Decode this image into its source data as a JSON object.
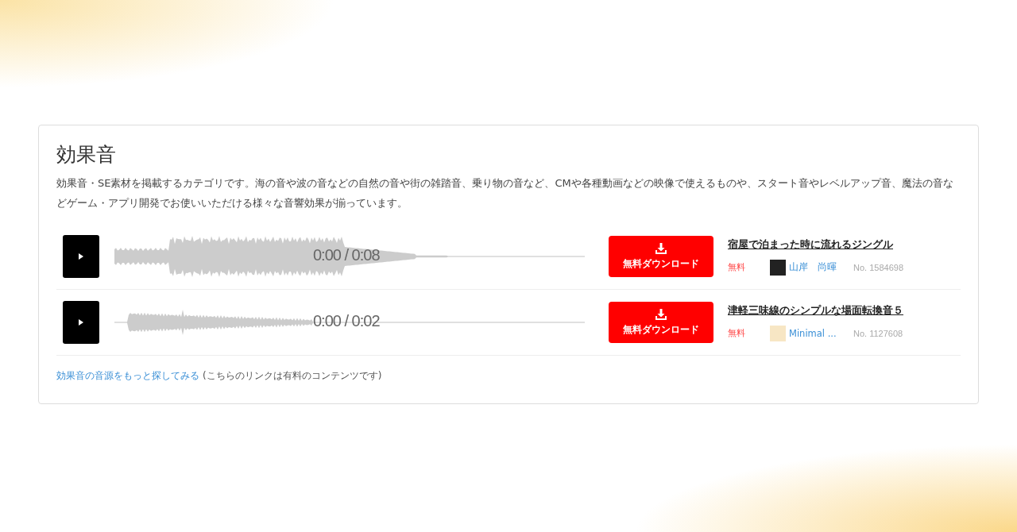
{
  "section": {
    "title": "効果音",
    "description": "効果音・SE素材を掲載するカテゴリです。海の音や波の音などの自然の音や街の雑踏音、乗り物の音など、CMや各種動画などの映像で使えるものや、スタート音やレベルアップ音、魔法の音などゲーム・アプリ開発でお使いいただける様々な音響効果が揃っています。"
  },
  "tracks": [
    {
      "time": "0:00 / 0:08",
      "download_label": "無料ダウンロード",
      "title": "宿屋で泊まった時に流れるジングル",
      "price": "無料",
      "author": "山岸　尚暉",
      "number": "No. 1584698"
    },
    {
      "time": "0:00 / 0:02",
      "download_label": "無料ダウンロード",
      "title": "津軽三味線のシンプルな場面転換音５",
      "price": "無料",
      "author": "Minimal ...",
      "number": "No. 1127608"
    }
  ],
  "more_link": {
    "link": "効果音の音源をもっと探してみる",
    "note": "(こちらのリンクは有料のコンテンツです)"
  }
}
